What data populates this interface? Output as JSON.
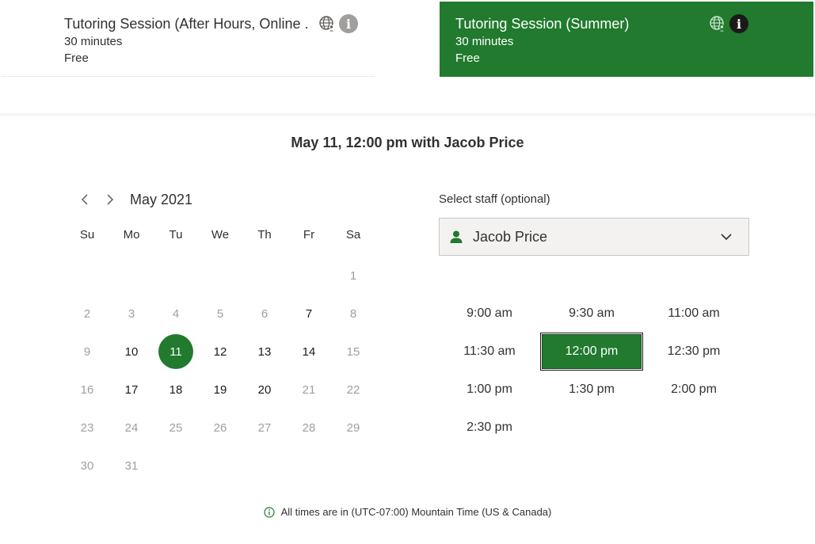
{
  "services": [
    {
      "title": "Tutoring Session (After Hours, Online ...",
      "duration": "30 minutes",
      "price": "Free",
      "selected": false
    },
    {
      "title": "Tutoring Session (Summer)",
      "duration": "30 minutes",
      "price": "Free",
      "selected": true
    }
  ],
  "selection_heading": "May 11, 12:00 pm with Jacob Price",
  "calendar": {
    "month_label": "May 2021",
    "weekdays": [
      "Su",
      "Mo",
      "Tu",
      "We",
      "Th",
      "Fr",
      "Sa"
    ],
    "weeks": [
      [
        null,
        null,
        null,
        null,
        null,
        null,
        {
          "d": "1",
          "s": "disabled"
        }
      ],
      [
        {
          "d": "2",
          "s": "disabled"
        },
        {
          "d": "3",
          "s": "disabled"
        },
        {
          "d": "4",
          "s": "disabled"
        },
        {
          "d": "5",
          "s": "disabled"
        },
        {
          "d": "6",
          "s": "disabled"
        },
        {
          "d": "7",
          "s": "available"
        },
        {
          "d": "8",
          "s": "disabled"
        }
      ],
      [
        {
          "d": "9",
          "s": "disabled"
        },
        {
          "d": "10",
          "s": "available"
        },
        {
          "d": "11",
          "s": "selected"
        },
        {
          "d": "12",
          "s": "available"
        },
        {
          "d": "13",
          "s": "available"
        },
        {
          "d": "14",
          "s": "available"
        },
        {
          "d": "15",
          "s": "disabled"
        }
      ],
      [
        {
          "d": "16",
          "s": "disabled"
        },
        {
          "d": "17",
          "s": "available"
        },
        {
          "d": "18",
          "s": "available"
        },
        {
          "d": "19",
          "s": "available"
        },
        {
          "d": "20",
          "s": "available"
        },
        {
          "d": "21",
          "s": "disabled"
        },
        {
          "d": "22",
          "s": "disabled"
        }
      ],
      [
        {
          "d": "23",
          "s": "disabled"
        },
        {
          "d": "24",
          "s": "disabled"
        },
        {
          "d": "25",
          "s": "disabled"
        },
        {
          "d": "26",
          "s": "disabled"
        },
        {
          "d": "27",
          "s": "disabled"
        },
        {
          "d": "28",
          "s": "disabled"
        },
        {
          "d": "29",
          "s": "disabled"
        }
      ],
      [
        {
          "d": "30",
          "s": "disabled"
        },
        {
          "d": "31",
          "s": "disabled"
        },
        null,
        null,
        null,
        null,
        null
      ]
    ]
  },
  "staff": {
    "label": "Select staff (optional)",
    "selected": "Jacob Price"
  },
  "time_slots": [
    {
      "time": "9:00 am",
      "selected": false
    },
    {
      "time": "9:30 am",
      "selected": false
    },
    {
      "time": "11:00 am",
      "selected": false
    },
    {
      "time": "11:30 am",
      "selected": false
    },
    {
      "time": "12:00 pm",
      "selected": true
    },
    {
      "time": "12:30 pm",
      "selected": false
    },
    {
      "time": "1:00 pm",
      "selected": false
    },
    {
      "time": "1:30 pm",
      "selected": false
    },
    {
      "time": "2:00 pm",
      "selected": false
    },
    {
      "time": "2:30 pm",
      "selected": false
    }
  ],
  "timezone_note": "All times are in (UTC-07:00) Mountain Time (US & Canada)",
  "colors": {
    "accent": "#217a2e",
    "disabled_text": "#a19f9d"
  },
  "icons": [
    "globe-person-icon",
    "info-icon",
    "chevron-left-icon",
    "chevron-right-icon",
    "person-icon",
    "chevron-down-icon",
    "info-small-icon"
  ]
}
